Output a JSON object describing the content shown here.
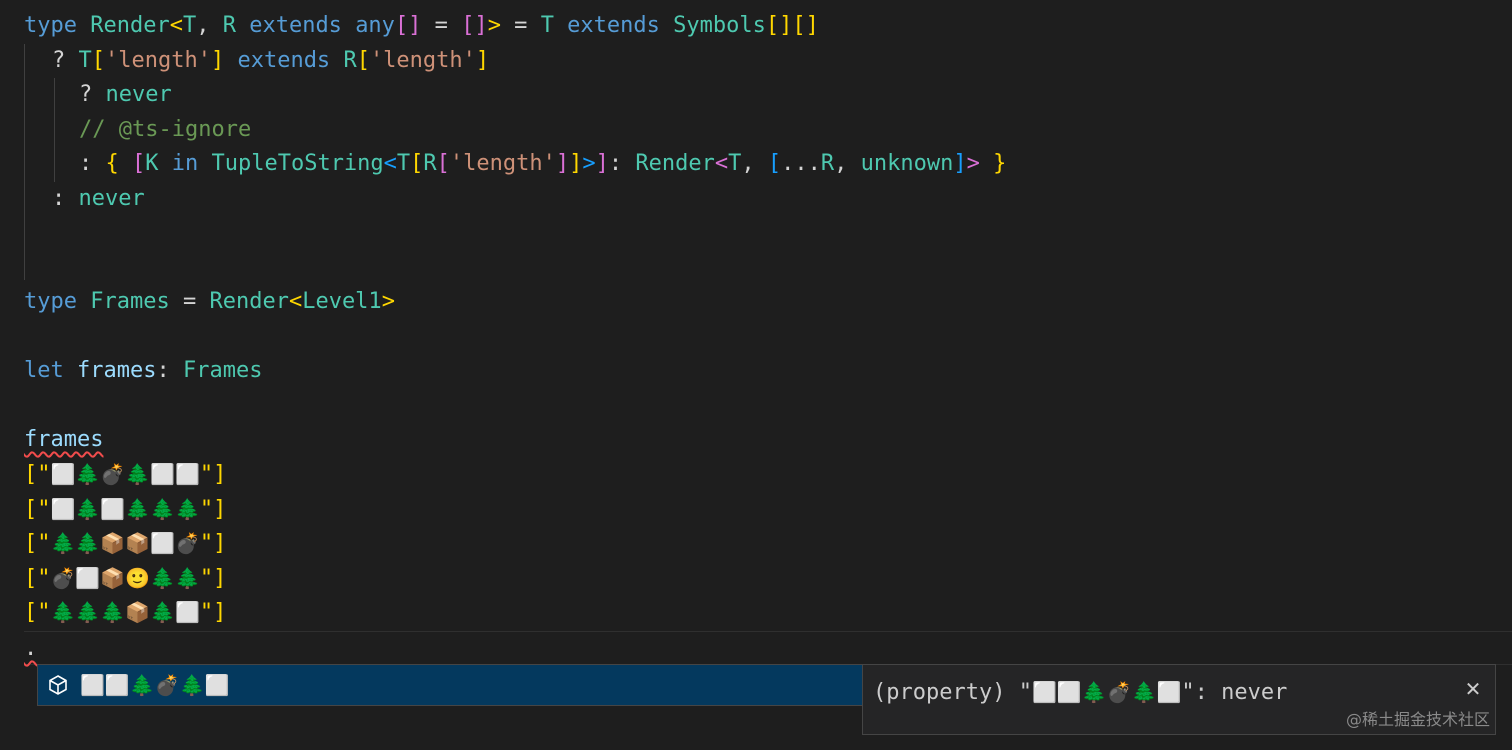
{
  "code": {
    "line1": {
      "kw_type": "type",
      "name": "Render",
      "open": "<",
      "t": "T",
      "comma": ", ",
      "r": "R",
      "extends": " extends ",
      "any": "any",
      "arr": "[]",
      "eq": " = ",
      "empty": "[]",
      "close": ">",
      "eq2": " = ",
      "t2": "T",
      "extends2": " extends ",
      "symbols": "Symbols",
      "brackets": "[][]"
    },
    "line2": {
      "q": "? ",
      "t": "T",
      "b1": "[",
      "str": "'length'",
      "b2": "]",
      "extends": " extends ",
      "r": "R",
      "b3": "[",
      "str2": "'length'",
      "b4": "]"
    },
    "line3": {
      "q": "? ",
      "never": "never"
    },
    "line4": {
      "comment": "// @ts-ignore"
    },
    "line5": {
      "colon": ": ",
      "lb": "{",
      "sp": " ",
      "sb": "[",
      "k": "K",
      "in": " in ",
      "tts": "TupleToString",
      "lt": "<",
      "t": "T",
      "b1": "[",
      "r": "R",
      "b2": "[",
      "str": "'length'",
      "b3": "]",
      "b4": "]",
      "gt": ">",
      "sb2": "]",
      "colon2": ": ",
      "render": "Render",
      "lt2": "<",
      "t2": "T",
      "comma": ", ",
      "ab": "[",
      "spread": "...",
      "r2": "R",
      "comma2": ", ",
      "unknown": "unknown",
      "ab2": "]",
      "gt2": ">",
      "sp2": " ",
      "rb": "}"
    },
    "line6": {
      "colon": ": ",
      "never": "never"
    },
    "frames_type": {
      "kw_type": "type",
      "name": "Frames",
      "eq": " = ",
      "render": "Render",
      "lt": "<",
      "level": "Level1",
      "gt": ">"
    },
    "let_line": {
      "kw_let": "let",
      "var": "frames",
      "colon": ": ",
      "type": "Frames"
    },
    "frames_ref": "frames",
    "frame_rows": [
      "⬜🌲💣🌲⬜⬜",
      "⬜🌲⬜🌲🌲🌲",
      "🌲🌲📦📦⬜💣",
      "💣⬜📦🙂🌲🌲",
      "🌲🌲🌲📦🌲⬜"
    ],
    "frame_open": "[\"",
    "frame_close": "\"]",
    "caret_line": "."
  },
  "suggest": {
    "icon": "property-cube-icon",
    "label": "⬜⬜🌲💣🌲⬜"
  },
  "details": {
    "prefix": "(property) \"",
    "emoji": "⬜⬜🌲💣🌲⬜",
    "suffix": "\": never"
  },
  "watermark": "@稀土掘金技术社区",
  "colors": {
    "background": "#1e1e1e",
    "keyword": "#569cd6",
    "type": "#4ec9b0",
    "string": "#ce9178",
    "comment": "#6a9955",
    "bracket_gold": "#ffd700",
    "bracket_purple": "#da70d6",
    "bracket_blue": "#179fff",
    "selection": "#04395e"
  }
}
